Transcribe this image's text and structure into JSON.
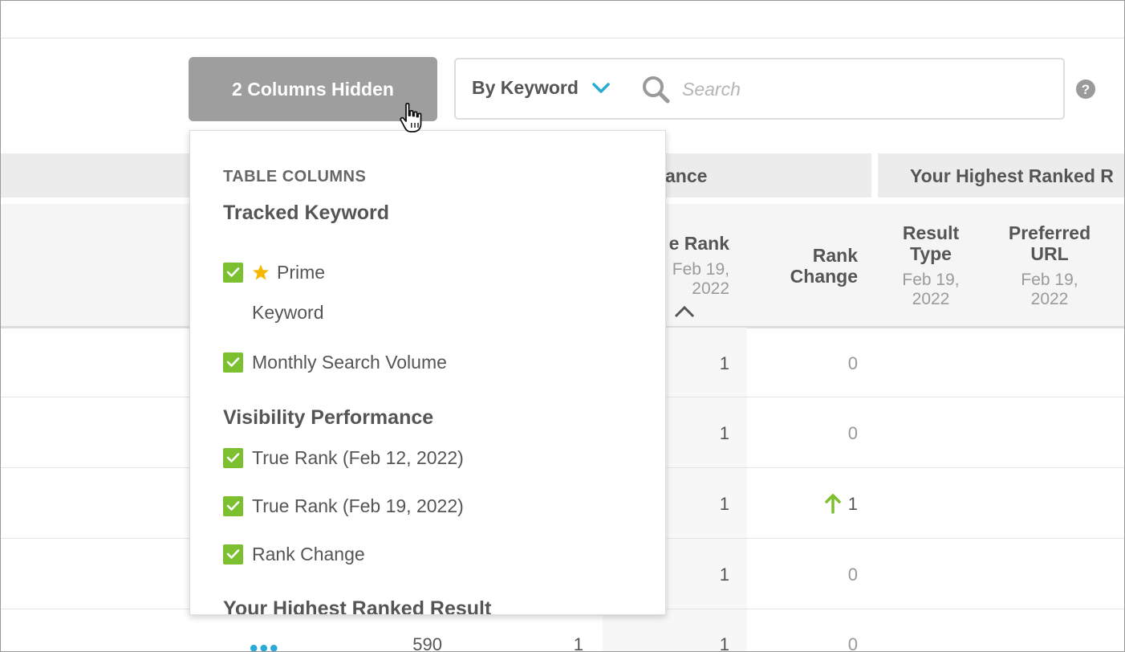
{
  "toolbar": {
    "columns_hidden_label": "2 Columns Hidden",
    "scope_label": "By Keyword",
    "search_placeholder": "Search"
  },
  "table": {
    "groups": [
      "ance",
      "Your Highest Ranked R"
    ],
    "headers": {
      "true_rank": {
        "label": "e Rank",
        "date_line1": "Feb 19,",
        "date_line2": "2022"
      },
      "rank_change": {
        "label_line1": "Rank",
        "label_line2": "Change"
      },
      "result_type": {
        "label_line1": "Result",
        "label_line2": "Type",
        "date_line1": "Feb 19,",
        "date_line2": "2022"
      },
      "preferred_url": {
        "label_line1": "Preferred",
        "label_line2": "URL",
        "date_line1": "Feb 19,",
        "date_line2": "2022"
      }
    },
    "rows": [
      {
        "true_rank": "1",
        "rank_change": "0"
      },
      {
        "true_rank": "1",
        "rank_change": "0"
      },
      {
        "true_rank": "1",
        "rank_change": "1",
        "trend": "up"
      },
      {
        "true_rank": "1",
        "rank_change": "0"
      },
      {
        "actions": "•••",
        "volume": "590",
        "prev_rank": "1",
        "true_rank": "1",
        "rank_change": "0"
      }
    ]
  },
  "dropdown": {
    "heading": "TABLE COLUMNS",
    "groups": [
      {
        "title": "Tracked Keyword"
      },
      {
        "title": "Visibility Performance"
      },
      {
        "title": "Your Highest Ranked Result"
      }
    ],
    "items": {
      "prime": "Prime",
      "keyword": "Keyword",
      "monthly_search_volume": "Monthly Search Volume",
      "true_rank_prev": "True Rank (Feb 12, 2022)",
      "true_rank_curr": "True Rank (Feb 19, 2022)",
      "rank_change": "Rank Change"
    }
  },
  "colors": {
    "accent_blue": "#29a9d6",
    "check_green": "#7cbf2f",
    "star_yellow": "#f5b800",
    "button_gray": "#9e9e9e"
  },
  "icons": [
    "pointer-hand-icon",
    "chevron-down-icon",
    "search-icon",
    "help-icon",
    "star-icon",
    "checkmark-icon",
    "arrow-up-icon",
    "caret-up-icon"
  ]
}
